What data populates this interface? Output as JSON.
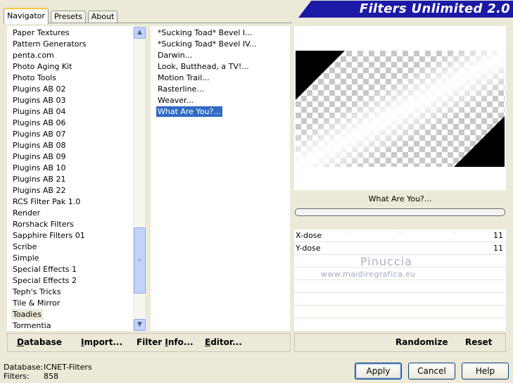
{
  "tabs": [
    {
      "label": "Navigator",
      "active": true
    },
    {
      "label": "Presets",
      "active": false
    },
    {
      "label": "About",
      "active": false
    }
  ],
  "banner": {
    "title": "Filters Unlimited 2.0",
    "color": "#1a1aa6"
  },
  "categories": {
    "items": [
      "Paper Textures",
      "Pattern Generators",
      "penta.com",
      "Photo Aging Kit",
      "Photo Tools",
      "Plugins AB 02",
      "Plugins AB 03",
      "Plugins AB 04",
      "Plugins AB 06",
      "Plugins AB 07",
      "Plugins AB 08",
      "Plugins AB 09",
      "Plugins AB 10",
      "Plugins AB 21",
      "Plugins AB 22",
      "RCS Filter Pak 1.0",
      "Render",
      "Rorshack Filters",
      "Sapphire Filters 01",
      "Scribe",
      "Simple",
      "Special Effects 1",
      "Special Effects 2",
      "Teph's Tricks",
      "Tile & Mirror",
      "Toadies",
      "Tormentia"
    ],
    "selected": "Toadies"
  },
  "filters": {
    "items": [
      "*Sucking Toad*  Bevel I...",
      "*Sucking Toad*  Bevel IV...",
      "Darwin...",
      "Look, Butthead, a TV!...",
      "Motion Trail...",
      "Rasterline...",
      "Weaver...",
      "What Are You?..."
    ],
    "selected": "What Are You?..."
  },
  "preview": {
    "filter_name": "What Are You?...",
    "progress": 0
  },
  "params": [
    {
      "name": "X-dose",
      "value": "11"
    },
    {
      "name": "Y-dose",
      "value": "11"
    }
  ],
  "watermark": {
    "line1": "Pinuccia",
    "line2": "www.maidiregrafica.eu"
  },
  "actions_left": {
    "database": {
      "pre": "",
      "ul": "D",
      "post": "atabase"
    },
    "import": {
      "pre": "",
      "ul": "I",
      "post": "mport..."
    },
    "filter_info": {
      "pre": "Filter ",
      "ul": "I",
      "post": "nfo..."
    },
    "editor": {
      "pre": "",
      "ul": "E",
      "post": "ditor..."
    }
  },
  "actions_right": {
    "randomize": "Randomize",
    "reset": "Reset"
  },
  "status": {
    "database_label": "Database:",
    "database_value": "ICNET-Filters",
    "filters_label": "Filters:",
    "filters_value": "858"
  },
  "buttons": {
    "apply": "Apply",
    "cancel": "Cancel",
    "help": "Help"
  }
}
